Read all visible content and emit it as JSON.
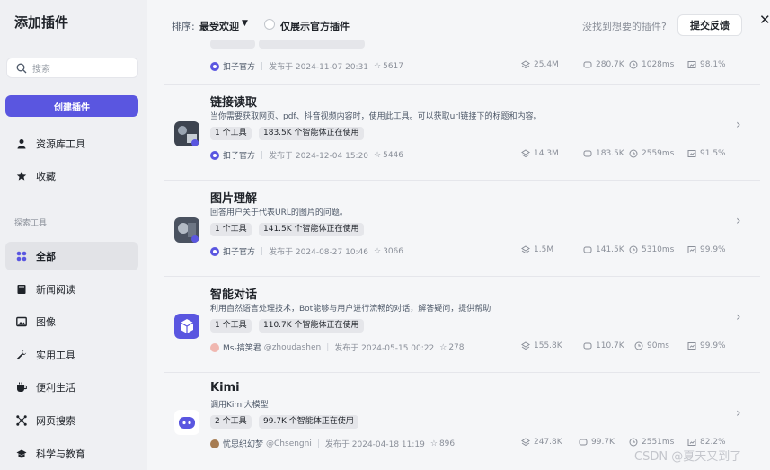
{
  "sidebar": {
    "title": "添加插件",
    "search_placeholder": "搜索",
    "create_button": "创建插件",
    "items_top": [
      {
        "label": "资源库工具",
        "icon": "person-icon"
      },
      {
        "label": "收藏",
        "icon": "star-icon"
      }
    ],
    "section_label": "探索工具",
    "items": [
      {
        "label": "全部",
        "icon": "grid-icon",
        "active": true
      },
      {
        "label": "新闻阅读",
        "icon": "book-icon"
      },
      {
        "label": "图像",
        "icon": "image-icon"
      },
      {
        "label": "实用工具",
        "icon": "wrench-icon"
      },
      {
        "label": "便利生活",
        "icon": "cup-icon"
      },
      {
        "label": "网页搜索",
        "icon": "network-icon"
      },
      {
        "label": "科学与教育",
        "icon": "graduation-cap-icon"
      }
    ]
  },
  "topbar": {
    "sort_label": "排序:",
    "sort_value": "最受欢迎",
    "official_only": "仅展示官方插件",
    "not_found": "没找到想要的插件?",
    "feedback": "提交反馈"
  },
  "plugins": [
    {
      "name": "",
      "owner": "扣子官方",
      "published": "发布于 2024-11-07 20:31",
      "stars": "5617",
      "stats": [
        "25.4M",
        "280.7K",
        "1028ms",
        "98.1%"
      ]
    },
    {
      "name": "链接读取",
      "desc": "当你需要获取网页、pdf、抖音视频内容时，使用此工具。可以获取url链接下的标题和内容。",
      "tags": [
        "1 个工具",
        "183.5K 个智能体正在使用"
      ],
      "owner": "扣子官方",
      "published": "发布于 2024-12-04 15:20",
      "stars": "5446",
      "stats": [
        "14.3M",
        "183.5K",
        "2559ms",
        "91.5%"
      ]
    },
    {
      "name": "图片理解",
      "desc": "回答用户关于代表URL的图片的问题。",
      "tags": [
        "1 个工具",
        "141.5K 个智能体正在使用"
      ],
      "owner": "扣子官方",
      "published": "发布于 2024-08-27 10:46",
      "stars": "3066",
      "stats": [
        "1.5M",
        "141.5K",
        "5310ms",
        "99.9%"
      ]
    },
    {
      "name": "智能对话",
      "desc": "利用自然语言处理技术，Bot能够与用户进行流畅的对话，解答疑问，提供帮助",
      "tags": [
        "1 个工具",
        "110.7K 个智能体正在使用"
      ],
      "owner": "Ms-搞笑君",
      "handle": "@zhoudashen",
      "published": "发布于 2024-05-15 00:22",
      "stars": "278",
      "stats": [
        "155.8K",
        "110.7K",
        "90ms",
        "99.9%"
      ]
    },
    {
      "name": "Kimi",
      "desc": "调用Kimi大模型",
      "tags": [
        "2 个工具",
        "99.7K 个智能体正在使用"
      ],
      "owner": "忧思织幻梦",
      "handle": "@Chsengni",
      "published": "发布于 2024-04-18 11:19",
      "stars": "896",
      "stats": [
        "247.8K",
        "99.7K",
        "2551ms",
        "82.2%"
      ]
    }
  ],
  "watermark": "CSDN @夏天又到了",
  "colors": {
    "accent": "#5a56e0",
    "sidebar_bg": "#eff0f3",
    "main_bg": "#f5f6f8"
  }
}
